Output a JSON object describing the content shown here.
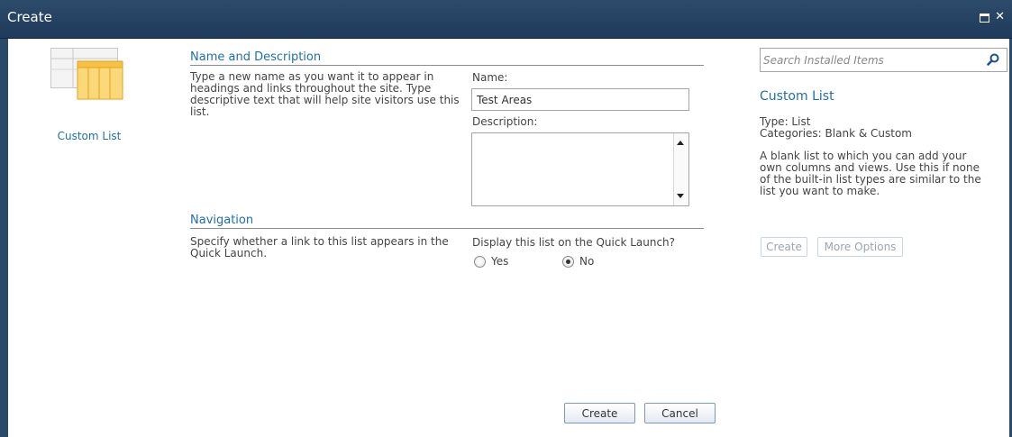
{
  "window": {
    "title": "Create"
  },
  "left_panel": {
    "template_label": "Custom List"
  },
  "name_section": {
    "title": "Name and Description",
    "help": "Type a new name as you want it to appear in headings and links throughout the site. Type descriptive text that will help site visitors use this list.",
    "name_label": "Name:",
    "name_value": "Test Areas",
    "description_label": "Description:",
    "description_value": ""
  },
  "navigation_section": {
    "title": "Navigation",
    "help": "Specify whether a link to this list appears in the Quick Launch.",
    "question": "Display this list on the Quick Launch?",
    "options": [
      {
        "label": "Yes",
        "selected": false
      },
      {
        "label": "No",
        "selected": true
      }
    ]
  },
  "footer": {
    "create_label": "Create",
    "cancel_label": "Cancel"
  },
  "right_panel": {
    "search_placeholder": "Search Installed Items",
    "title": "Custom List",
    "type_line": "Type: List",
    "categories_line": "Categories: Blank & Custom",
    "description": "A blank list to which you can add your own columns and views. Use this if none of the built-in list types are similar to the list you want to make.",
    "create_label": "Create",
    "more_options_label": "More Options"
  },
  "colors": {
    "titlebar": "#1f3a5a",
    "accent_text": "#1f6fa8",
    "button_border": "#7a99bd"
  }
}
